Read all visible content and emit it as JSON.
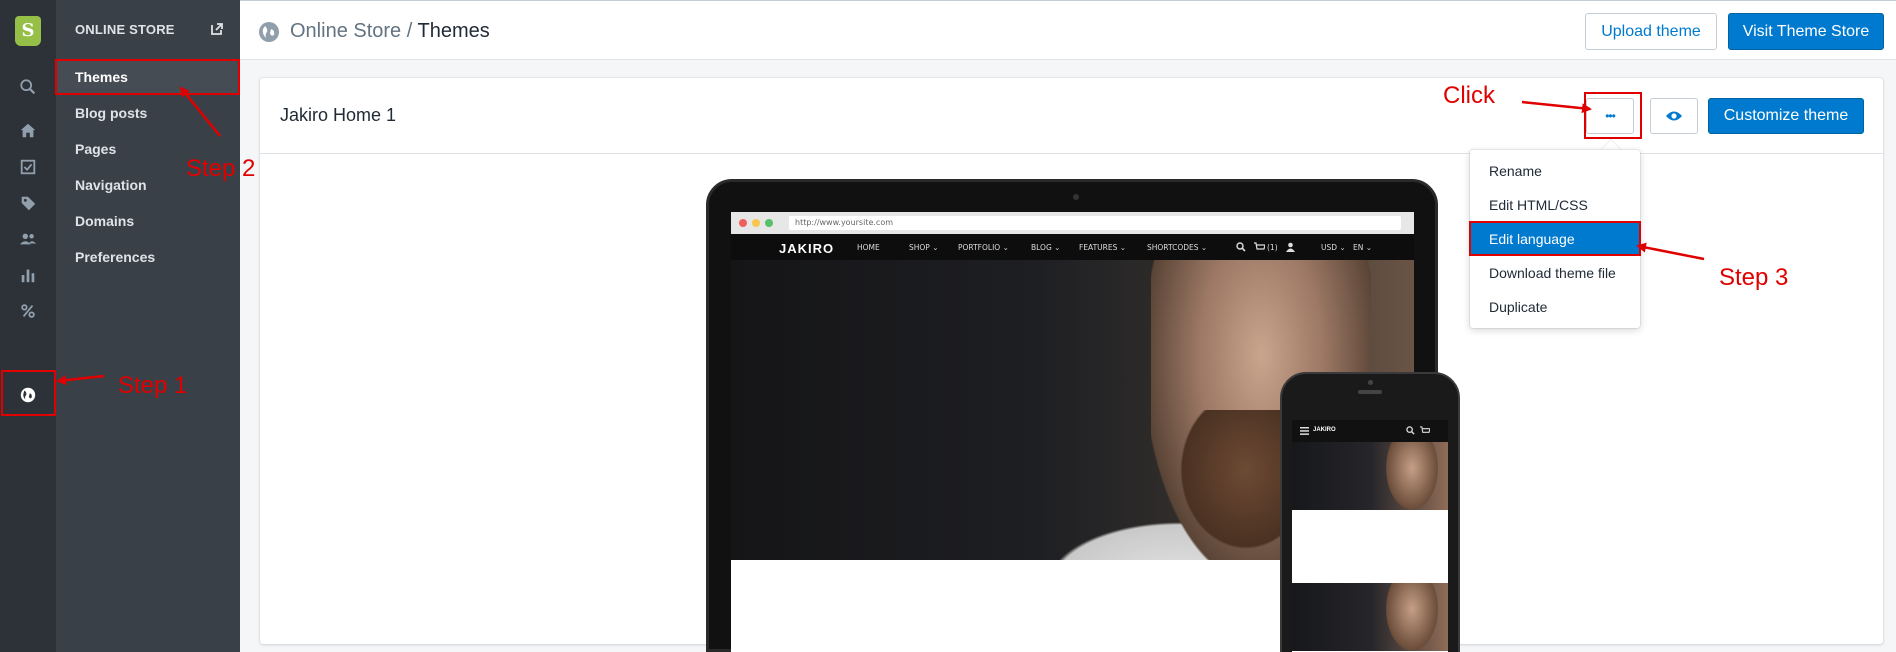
{
  "rail": {
    "icons": [
      "shopify-logo-icon",
      "search-icon",
      "home-icon",
      "orders-icon",
      "tag-icon",
      "customers-icon",
      "analytics-icon",
      "discounts-icon",
      "online-store-icon"
    ]
  },
  "subnav": {
    "header": "ONLINE STORE",
    "items": [
      {
        "label": "Themes"
      },
      {
        "label": "Blog posts"
      },
      {
        "label": "Pages"
      },
      {
        "label": "Navigation"
      },
      {
        "label": "Domains"
      },
      {
        "label": "Preferences"
      }
    ]
  },
  "topbar": {
    "breadcrumb_parent": "Online Store",
    "breadcrumb_sep": " / ",
    "breadcrumb_current": "Themes",
    "upload_label": "Upload theme",
    "visit_store_label": "Visit Theme Store"
  },
  "theme_card": {
    "title": "Jakiro Home 1",
    "more_label": "•••",
    "customize_label": "Customize theme"
  },
  "actions_menu": {
    "items": [
      {
        "label": "Rename"
      },
      {
        "label": "Edit HTML/CSS"
      },
      {
        "label": "Edit language"
      },
      {
        "label": "Download theme file"
      },
      {
        "label": "Duplicate"
      }
    ],
    "selected": "Edit language"
  },
  "annotations": {
    "step1": "Step 1",
    "step2": "Step 2",
    "step3": "Step 3",
    "click": "Click",
    "color": "#e00000"
  },
  "preview": {
    "url": "http://www.yoursite.com",
    "logo": "JAKIRO",
    "nav": [
      "HOME",
      "SHOP ⌄",
      "PORTFOLIO ⌄",
      "BLOG ⌄",
      "FEATURES ⌄",
      "SHORTCODES ⌄"
    ],
    "cart": "(1)",
    "currency": "USD ⌄",
    "language": "EN ⌄",
    "mobile_logo": "JAKIRO"
  },
  "colors": {
    "rail_bg": "#2d3239",
    "subnav_bg": "#3a4047",
    "primary": "#007ace",
    "shopify_green": "#95bf47"
  }
}
